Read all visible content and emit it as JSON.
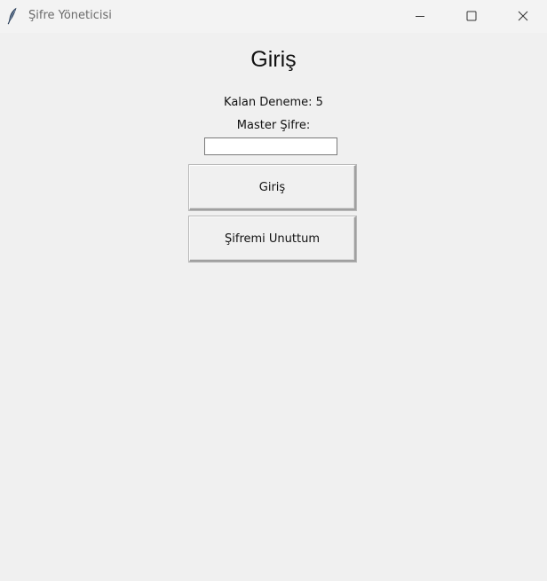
{
  "window": {
    "title": "Şifre Yöneticisi",
    "app_icon": "feather-icon",
    "controls": {
      "minimize_icon": "minimize-icon",
      "maximize_icon": "maximize-icon",
      "close_icon": "close-icon"
    }
  },
  "login": {
    "heading": "Giriş",
    "attempts_label": "Kalan Deneme: 5",
    "master_label": "Master Şifre:",
    "password_value": "",
    "login_button": "Giriş",
    "forgot_button": "Şifremi Unuttum"
  }
}
